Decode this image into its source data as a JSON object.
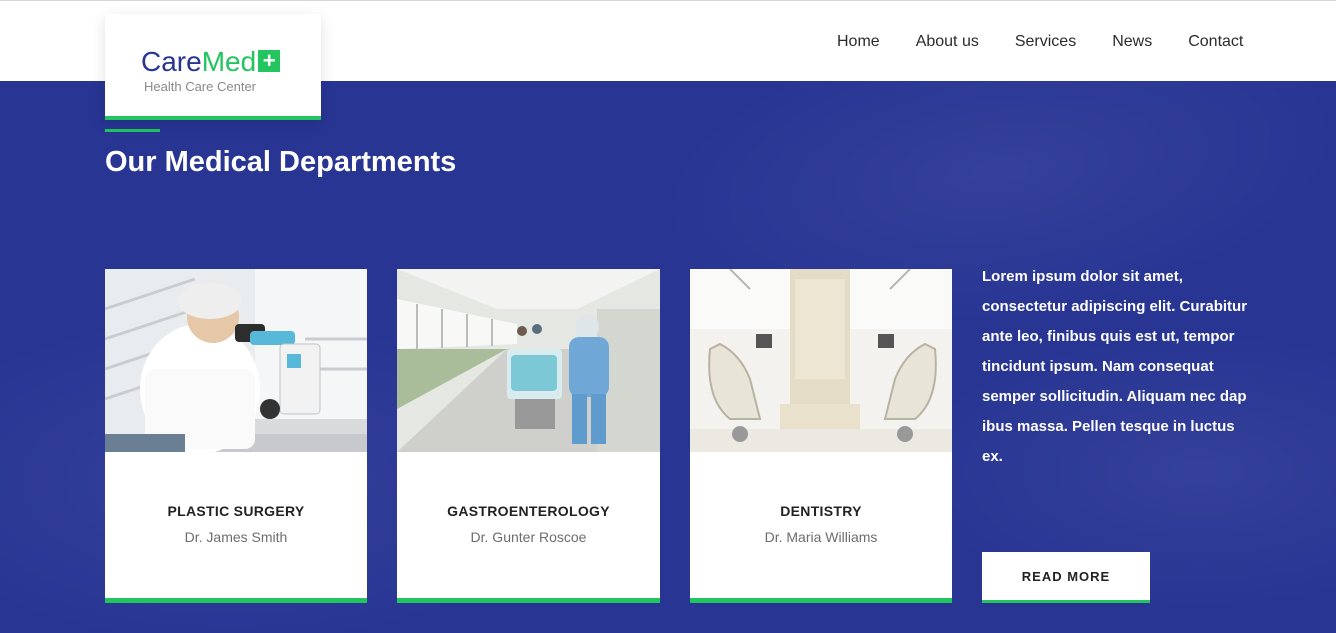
{
  "brand": {
    "name_part1": "Care",
    "name_part2": "Med",
    "plus_icon": "+",
    "tagline": "Health Care Center",
    "colors": {
      "primary": "#283593",
      "accent": "#22c55e"
    }
  },
  "nav": {
    "items": [
      {
        "label": "Home"
      },
      {
        "label": "About us"
      },
      {
        "label": "Services"
      },
      {
        "label": "News"
      },
      {
        "label": "Contact"
      }
    ]
  },
  "section": {
    "title": "Our Medical Departments",
    "description": "Lorem ipsum dolor sit amet, consectetur adipiscing elit. Curabitur ante leo, finibus quis est ut, tempor tincidunt ipsum. Nam consequat semper sollicitudin. Aliquam nec dap ibus massa. Pellen tesque in luctus ex.",
    "read_more_label": "READ MORE"
  },
  "departments": [
    {
      "title": "PLASTIC SURGERY",
      "doctor": "Dr. James Smith",
      "image": "lab-microscope-photo"
    },
    {
      "title": "GASTROENTEROLOGY",
      "doctor": "Dr. Gunter Roscoe",
      "image": "hospital-corridor-photo"
    },
    {
      "title": "DENTISTRY",
      "doctor": "Dr. Maria Williams",
      "image": "dental-clinic-photo"
    }
  ]
}
